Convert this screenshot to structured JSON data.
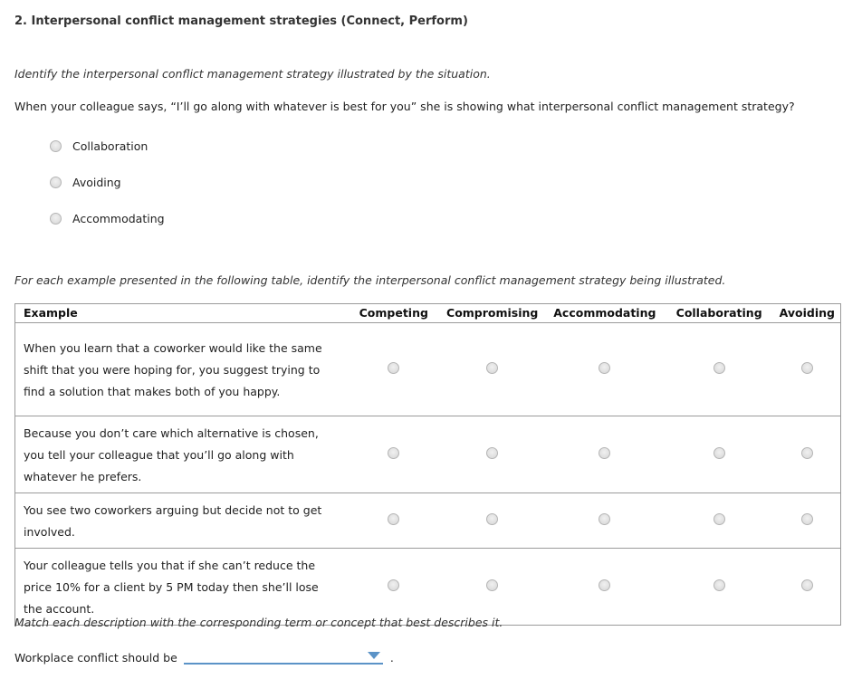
{
  "question_title": "2. Interpersonal conflict management strategies (Connect, Perform)",
  "part1": {
    "instruction": "Identify the interpersonal conflict management strategy illustrated by the situation.",
    "question": "When your colleague says, “I’ll go along with whatever is best for you” she is showing what interpersonal conflict management strategy?",
    "options": [
      {
        "label": "Collaboration",
        "selected": false
      },
      {
        "label": "Avoiding",
        "selected": false
      },
      {
        "label": "Accommodating",
        "selected": false
      }
    ]
  },
  "part2": {
    "instruction": "For each example presented in the following table, identify the interpersonal conflict management strategy being illustrated.",
    "columns": [
      "Example",
      "Competing",
      "Compromising",
      "Accommodating",
      "Collaborating",
      "Avoiding"
    ],
    "rows": [
      {
        "example": "When you learn that a coworker would like the same shift that you were hoping for, you suggest trying to find a solution that makes both of you happy.",
        "selected": null
      },
      {
        "example": "Because you don’t care which alternative is chosen, you tell your colleague that you’ll go along with whatever he prefers.",
        "selected": null
      },
      {
        "example": "You see two coworkers arguing but decide not to get involved.",
        "selected": null
      },
      {
        "example": "Your colleague tells you that if she can’t reduce the price 10% for a client by 5 PM today then she’ll lose the account.",
        "selected": null
      }
    ]
  },
  "part3": {
    "instruction": "Match each description with the corresponding term or concept that best describes it.",
    "sentence_prefix": "Workplace conflict should be",
    "dropdown_value": "",
    "sentence_suffix": ".",
    "dropdown_icon": "caret-down-icon",
    "accent_color": "#5b93c7"
  }
}
